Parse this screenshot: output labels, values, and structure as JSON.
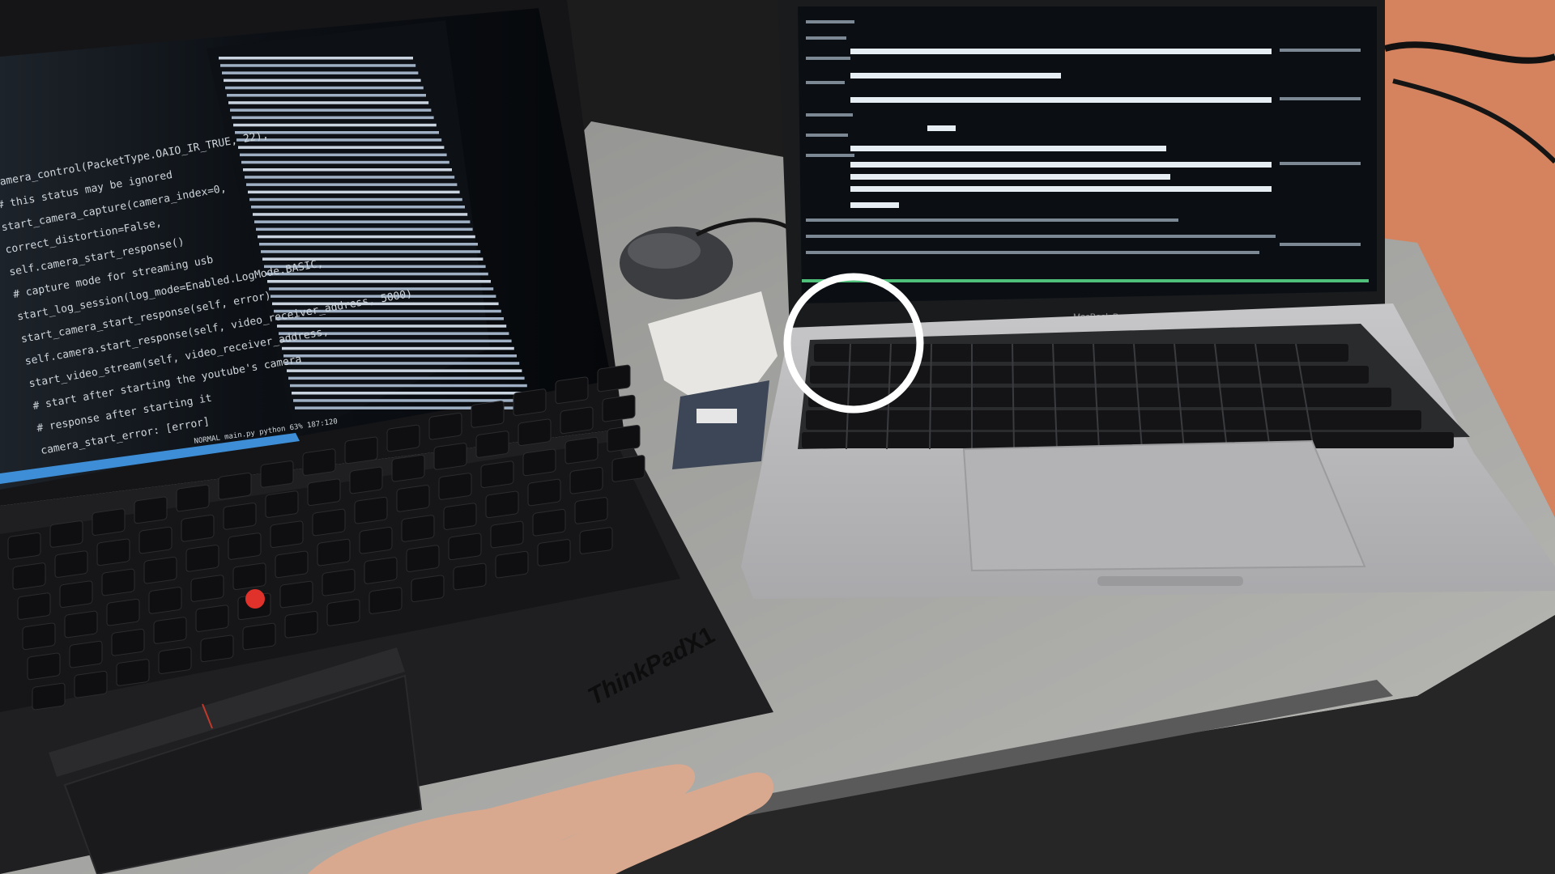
{
  "scene": {
    "left_laptop": {
      "brand": "ThinkPad",
      "brand_suffix": "X1",
      "code_lines": [
        "camera_control(PacketType.OAIO_IR_TRUE, 22),",
        "  # this status may be ignored",
        "start_camera_capture(camera_index=0,",
        "  correct_distortion=False,",
        "self.camera_start_response()",
        "  # capture mode for streaming usb",
        "start_log_session(log_mode=Enabled.LogMode.BASIC,",
        "start_camera_start_response(self, error)",
        "self.camera.start_response(self, video_receiver_address, 5000)",
        "start_video_stream(self, video_receiver_address,",
        "  # start after starting the youtube's camera",
        "  # response after starting it",
        "camera_start_error: [error]"
      ],
      "status_bar": "NORMAL  main.py  python  63% 187:120"
    },
    "right_laptop": {
      "brand": "MacBook Pro"
    },
    "annotation": {
      "type": "circle",
      "color": "#ffffff",
      "target": "top-left keys of MacBook keyboard"
    },
    "colors": {
      "desk": "#a8a8a6",
      "table_orange": "#d5835e",
      "thinkpad_body": "#1f1f21",
      "macbook_body": "#bcbcbe",
      "terminal_bg": "#0b0f14",
      "trackpoint_red": "#e0322a"
    }
  }
}
